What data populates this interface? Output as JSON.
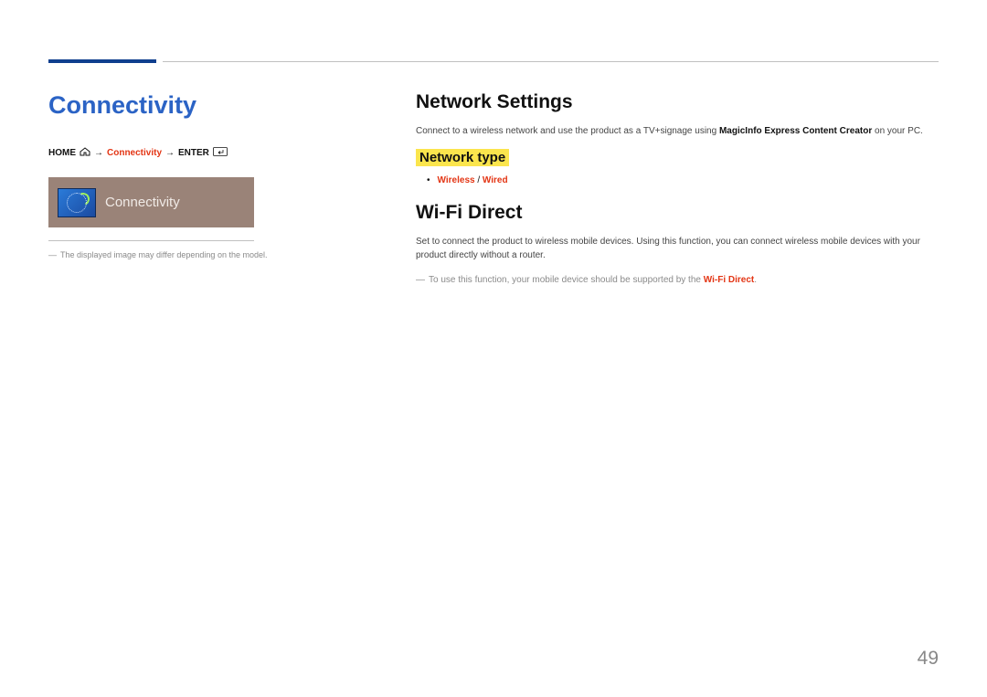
{
  "left": {
    "title": "Connectivity",
    "breadcrumb": {
      "home": "HOME",
      "arrow": "→",
      "mid": "Connectivity",
      "enter": "ENTER"
    },
    "tile_label": "Connectivity",
    "disclaimer_dash": "―",
    "disclaimer": "The displayed image may differ depending on the model."
  },
  "right": {
    "h1": "Network Settings",
    "p1_pre": "Connect to a wireless network and use the product as a TV+signage using ",
    "p1_bold": "MagicInfo Express Content Creator",
    "p1_post": " on your PC.",
    "subhead": "Network type",
    "bullet": {
      "dot": "•",
      "opt1": "Wireless",
      "slash": " / ",
      "opt2": "Wired"
    },
    "h2": "Wi-Fi Direct",
    "p2": "Set to connect the product to wireless mobile devices. Using this function, you can connect wireless mobile devices with your product directly without a router.",
    "note_dash": "―",
    "note_pre": "To use this function, your mobile device should be supported by the ",
    "note_bold": "Wi-Fi Direct",
    "note_post": "."
  },
  "page_number": "49"
}
